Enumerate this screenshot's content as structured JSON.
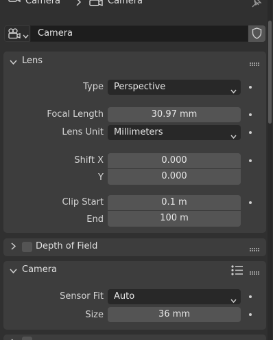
{
  "breadcrumb": {
    "item1_label": "Camera",
    "item2_label": "Camera"
  },
  "datablock": {
    "name": "Camera"
  },
  "lens_panel": {
    "title": "Lens",
    "type_label": "Type",
    "type_value": "Perspective",
    "focal_length_label": "Focal Length",
    "focal_length_value": "30.97 mm",
    "lens_unit_label": "Lens Unit",
    "lens_unit_value": "Millimeters",
    "shift_x_label": "Shift X",
    "shift_x_value": "0.000",
    "shift_y_label": "Y",
    "shift_y_value": "0.000",
    "clip_start_label": "Clip Start",
    "clip_start_value": "0.1 m",
    "clip_end_label": "End",
    "clip_end_value": "100 m"
  },
  "dof_panel": {
    "title": "Depth of Field"
  },
  "camera_panel": {
    "title": "Camera",
    "sensor_fit_label": "Sensor Fit",
    "sensor_fit_value": "Auto",
    "size_label": "Size",
    "size_value": "36 mm"
  },
  "colors": {
    "background": "#303030",
    "panel": "#3d3d3d",
    "field": "#545454",
    "dropdown": "#282828"
  }
}
